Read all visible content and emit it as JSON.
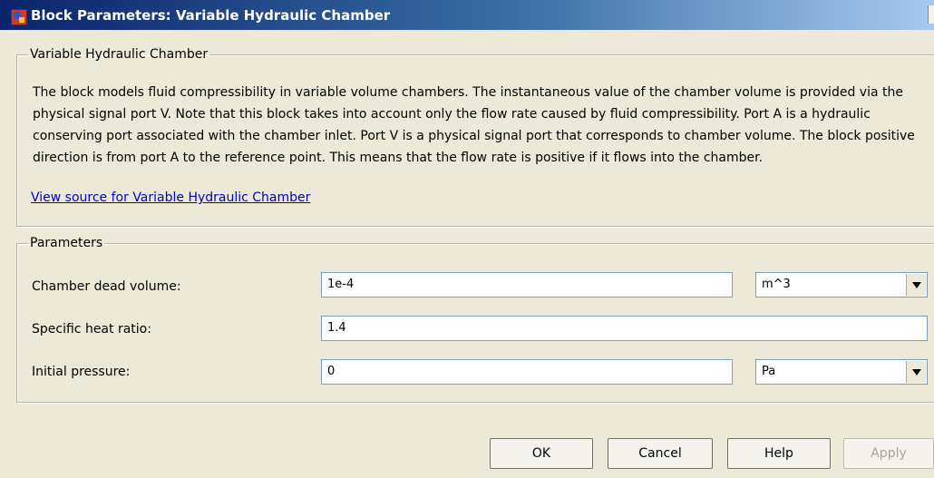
{
  "window": {
    "title": "Block Parameters: Variable Hydraulic Chamber"
  },
  "description_group": {
    "legend": "Variable Hydraulic Chamber",
    "text": "The block models fluid compressibility in variable volume chambers. The instantaneous value of the chamber volume is provided via the physical signal port V. Note that this block takes into account only the flow rate caused by fluid compressibility. Port A is a hydraulic conserving port associated with the chamber inlet. Port V is a physical signal port that corresponds to chamber volume. The block positive direction is from port A to the reference point. This means that the flow rate is positive if it flows into the chamber.",
    "source_link": "View source for Variable Hydraulic Chamber"
  },
  "parameters": {
    "legend": "Parameters",
    "chamber_dead_volume": {
      "label": "Chamber dead volume:",
      "value": "1e-4",
      "unit": "m^3"
    },
    "specific_heat_ratio": {
      "label": "Specific heat ratio:",
      "value": "1.4"
    },
    "initial_pressure": {
      "label": "Initial pressure:",
      "value": "0",
      "unit": "Pa"
    }
  },
  "buttons": {
    "ok": "OK",
    "cancel": "Cancel",
    "help": "Help",
    "apply": "Apply"
  }
}
